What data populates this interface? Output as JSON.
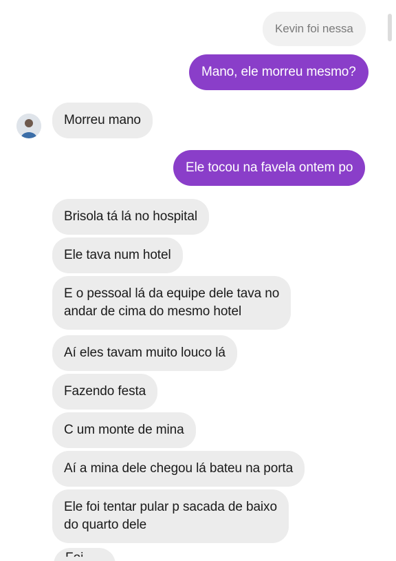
{
  "conversation": {
    "preview_text": "Kevin foi nessa",
    "messages": [
      {
        "from": "me",
        "text": "Mano, ele morreu mesmo?"
      },
      {
        "from": "them",
        "text": "Morreu mano"
      },
      {
        "from": "me",
        "text": "Ele tocou na favela ontem po"
      },
      {
        "from": "them",
        "text": "Brisola tá lá no hospital"
      },
      {
        "from": "them",
        "text": "Ele tava num hotel"
      },
      {
        "from": "them",
        "lines": [
          "E o pessoal lá da equipe dele tava no",
          "andar de cima do mesmo hotel"
        ]
      },
      {
        "from": "them",
        "text": "Aí eles tavam muito louco lá"
      },
      {
        "from": "them",
        "text": "Fazendo festa"
      },
      {
        "from": "them",
        "text": "C um monte de mina"
      },
      {
        "from": "them",
        "text": "Aí a mina dele chegou lá bateu na porta"
      },
      {
        "from": "them",
        "lines": [
          "Ele foi tentar pular p sacada de baixo",
          "do quarto dele"
        ]
      },
      {
        "from": "them",
        "text": "Foi..."
      }
    ]
  },
  "colors": {
    "outgoing": "#8a3ec9",
    "incoming": "#ececec"
  }
}
